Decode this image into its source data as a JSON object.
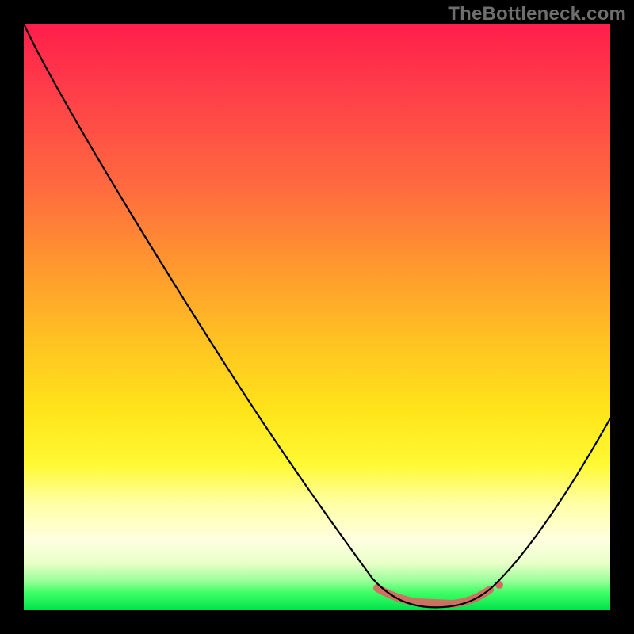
{
  "watermark": "TheBottleneck.com",
  "chart_data": {
    "type": "line",
    "title": "",
    "xlabel": "",
    "ylabel": "",
    "xlim": [
      0,
      1
    ],
    "ylim": [
      0,
      1
    ],
    "series": [
      {
        "name": "bottleneck_curve",
        "x": [
          0.0,
          0.04,
          0.1,
          0.2,
          0.3,
          0.4,
          0.5,
          0.58,
          0.63,
          0.68,
          0.73,
          0.78,
          0.85,
          0.92,
          1.0
        ],
        "y": [
          1.0,
          0.96,
          0.86,
          0.7,
          0.54,
          0.38,
          0.22,
          0.1,
          0.04,
          0.01,
          0.01,
          0.03,
          0.1,
          0.2,
          0.33
        ]
      }
    ],
    "highlight_range_x": [
      0.6,
      0.8
    ],
    "background_gradient": {
      "top": "#ff1e4b",
      "mid": "#ffe41a",
      "bottom": "#00e24a"
    }
  }
}
